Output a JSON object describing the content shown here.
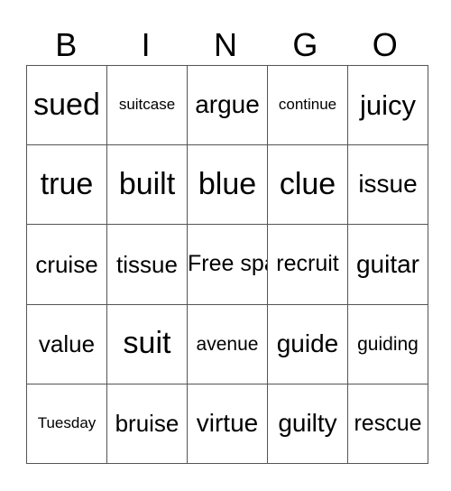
{
  "header": [
    "B",
    "I",
    "N",
    "G",
    "O"
  ],
  "rows": [
    [
      "sued",
      "suitcase",
      "argue",
      "continue",
      "juicy"
    ],
    [
      "true",
      "built",
      "blue",
      "clue",
      "issue"
    ],
    [
      "cruise",
      "tissue",
      "Free space",
      "recruit",
      "guitar"
    ],
    [
      "value",
      "suit",
      "avenue",
      "guide",
      "guiding"
    ],
    [
      "Tuesday",
      "bruise",
      "virtue",
      "guilty",
      "rescue"
    ]
  ],
  "colors": {
    "grid_line": "#555555",
    "text": "#000000",
    "background": "#ffffff"
  }
}
